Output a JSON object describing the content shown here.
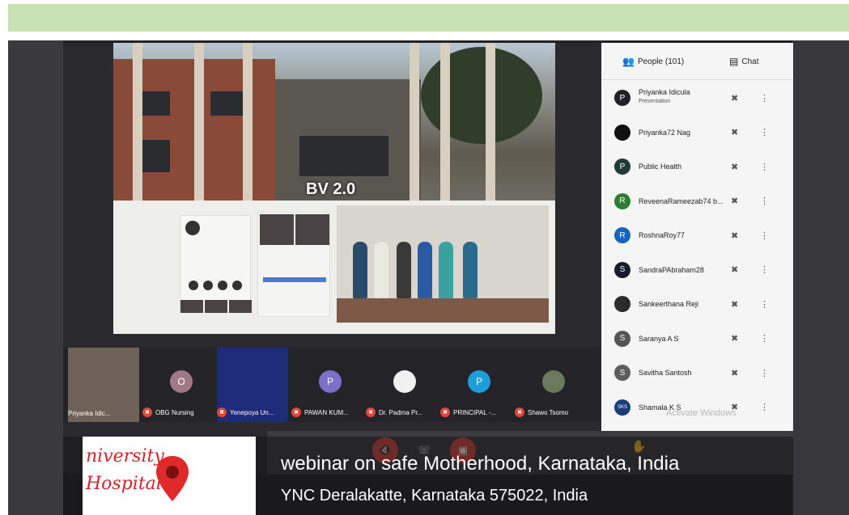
{
  "slide": {
    "title": "BV 2.0"
  },
  "sidebar": {
    "tabs": [
      {
        "label": "People (101)",
        "icon": "people-icon"
      },
      {
        "label": "Chat",
        "icon": "chat-icon"
      }
    ],
    "participants": [
      {
        "name": "Priyanka Idicula",
        "sub": "Presentation",
        "avatar": "P",
        "color": "#202124"
      },
      {
        "name": "Priyanka72 Nag",
        "avatar": "",
        "color": "#111111"
      },
      {
        "name": "Public Health",
        "avatar": "P",
        "color": "#1e3a3a"
      },
      {
        "name": "ReveenaRameezab74 b...",
        "avatar": "R",
        "color": "#2e7d32"
      },
      {
        "name": "RoshnaRoy77",
        "avatar": "R",
        "color": "#1565c0"
      },
      {
        "name": "SandraPAbraham28",
        "avatar": "S",
        "color": "#1a1a2e"
      },
      {
        "name": "Sankeerthana Reji",
        "avatar": "",
        "color": "#2b2b2b"
      },
      {
        "name": "Saranya A S",
        "avatar": "S",
        "color": "#555555"
      },
      {
        "name": "Savitha Santosh",
        "avatar": "S",
        "color": "#5d5d5d"
      },
      {
        "name": "Shamala K S",
        "avatar": "SKS",
        "color": "#1a3d7a"
      }
    ],
    "watermark": "Activate Windows"
  },
  "tiles": [
    {
      "name": "Priyanka Idic...",
      "avatar": "",
      "color": "#8a7a6a",
      "muted": false
    },
    {
      "name": "OBG Nursing",
      "avatar": "O",
      "color": "#a07888",
      "muted": true
    },
    {
      "name": "Yenepoya Un...",
      "avatar": "",
      "color": "#1e2a7a",
      "muted": true
    },
    {
      "name": "PAWAN KUM...",
      "avatar": "P",
      "color": "#7b6fc8",
      "muted": true
    },
    {
      "name": "Dr. Padma Pr...",
      "avatar": "",
      "color": "#f0f0f0",
      "muted": true
    },
    {
      "name": "PRINCIPAL -...",
      "avatar": "P",
      "color": "#1e9ed8",
      "muted": true
    },
    {
      "name": "Shawo Tsomo",
      "avatar": "",
      "color": "#6a7a5a",
      "muted": true
    }
  ],
  "overlay": {
    "logo_line1": "niversity",
    "logo_line2": "Hospital",
    "title": "webinar on safe Motherhood, Karnataka, India",
    "address": "YNC Deralakatte, Karnataka 575022, India"
  }
}
